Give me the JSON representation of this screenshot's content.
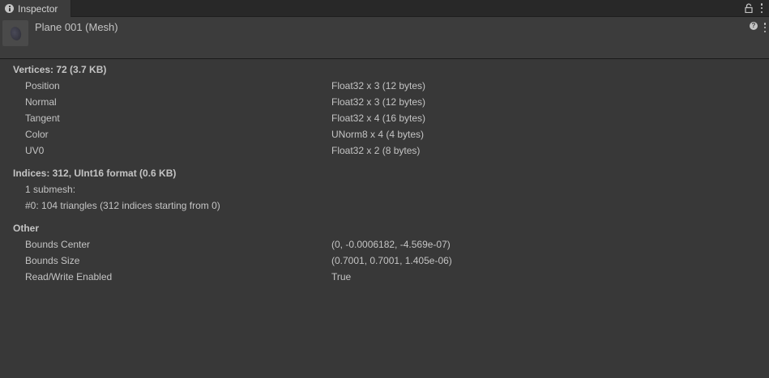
{
  "tab": {
    "label": "Inspector"
  },
  "header": {
    "title": "Plane 001 (Mesh)"
  },
  "vertices": {
    "title": "Vertices: 72 (3.7 KB)",
    "rows": [
      {
        "label": "Position",
        "value": "Float32 x 3 (12 bytes)"
      },
      {
        "label": "Normal",
        "value": "Float32 x 3 (12 bytes)"
      },
      {
        "label": "Tangent",
        "value": "Float32 x 4 (16 bytes)"
      },
      {
        "label": "Color",
        "value": "UNorm8 x 4 (4 bytes)"
      },
      {
        "label": "UV0",
        "value": "Float32 x 2 (8 bytes)"
      }
    ]
  },
  "indices": {
    "title": "Indices: 312, UInt16 format (0.6 KB)",
    "lines": [
      "1 submesh:",
      "#0: 104 triangles (312 indices starting from 0)"
    ]
  },
  "other": {
    "title": "Other",
    "rows": [
      {
        "label": "Bounds Center",
        "value": "(0, -0.0006182, -4.569e-07)"
      },
      {
        "label": "Bounds Size",
        "value": "(0.7001, 0.7001, 1.405e-06)"
      },
      {
        "label": "Read/Write Enabled",
        "value": "True"
      }
    ]
  }
}
